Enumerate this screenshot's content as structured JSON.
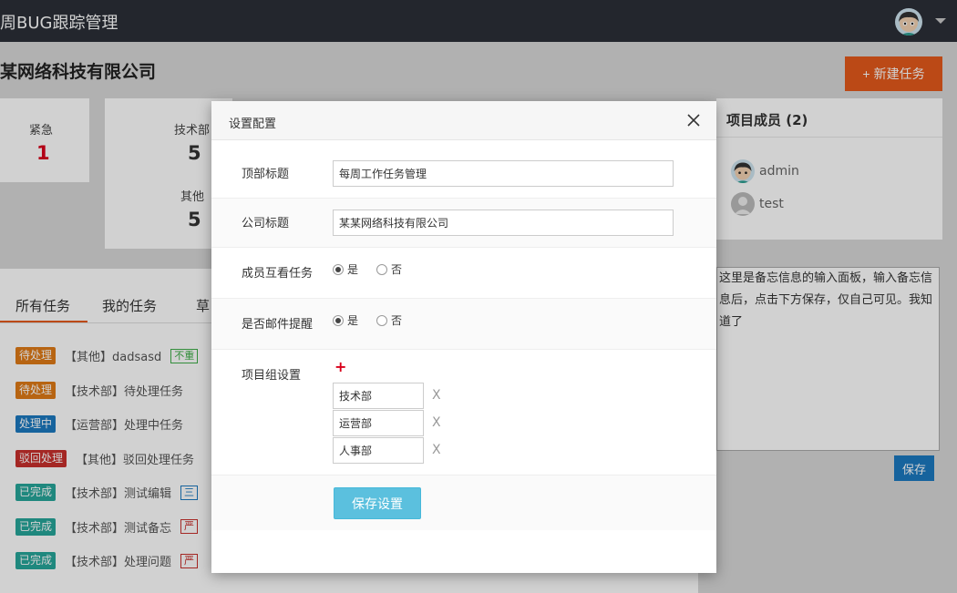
{
  "header": {
    "title": "周BUG跟踪管理"
  },
  "company": {
    "name": "某网络科技有限公司"
  },
  "new_task": {
    "icon": "plus-icon",
    "label": "新建任务"
  },
  "stats": {
    "urgent": {
      "label": "紧急",
      "value": "1"
    },
    "depts": [
      {
        "label": "技术部",
        "value": "5"
      },
      {
        "label": "其他",
        "value": "5"
      }
    ]
  },
  "members": {
    "title": "项目成员 (2)",
    "list": [
      {
        "name": "admin"
      },
      {
        "name": "test"
      }
    ]
  },
  "memo": {
    "text": "这里是备忘信息的输入面板，输入备忘信息后，点击下方保存，仅自己可见。我知道了",
    "save": "保存"
  },
  "tabs": [
    "所有任务",
    "我的任务",
    "草"
  ],
  "tasks": [
    {
      "status": "待处理",
      "color": "#e07a17",
      "text": "【其他】dadsasd",
      "tag": "不重",
      "tag_color": "#3fae49"
    },
    {
      "status": "待处理",
      "color": "#e07a17",
      "text": "【技术部】待处理任务",
      "tag": "",
      "tag_color": ""
    },
    {
      "status": "处理中",
      "color": "#1c79c0",
      "text": "【运营部】处理中任务",
      "tag": "",
      "tag_color": ""
    },
    {
      "status": "驳回处理",
      "color": "#c9302c",
      "text": "【其他】驳回处理任务",
      "tag": "",
      "tag_color": ""
    },
    {
      "status": "已完成",
      "color": "#26a69a",
      "text": "【技术部】测试编辑",
      "tag": "三",
      "tag_color": "#1c79c0"
    },
    {
      "status": "已完成",
      "color": "#26a69a",
      "text": "【技术部】测试备忘",
      "tag": "严",
      "tag_color": "#c9302c"
    },
    {
      "status": "已完成",
      "color": "#26a69a",
      "text": "【技术部】处理问题",
      "tag": "严",
      "tag_color": "#c9302c"
    }
  ],
  "modal": {
    "title": "设置配置",
    "top_title": {
      "label": "顶部标题",
      "value": "每周工作任务管理"
    },
    "company_title": {
      "label": "公司标题",
      "value": "某某网络科技有限公司"
    },
    "mutual_view": {
      "label": "成员互看任务",
      "yes": "是",
      "no": "否",
      "selected": "是"
    },
    "email_remind": {
      "label": "是否邮件提醒",
      "yes": "是",
      "no": "否",
      "selected": "是"
    },
    "groups": {
      "label": "项目组设置",
      "add_icon": "+",
      "remove_icon": "X",
      "items": [
        "技术部",
        "运营部",
        "人事部"
      ]
    },
    "save_label": "保存设置"
  }
}
